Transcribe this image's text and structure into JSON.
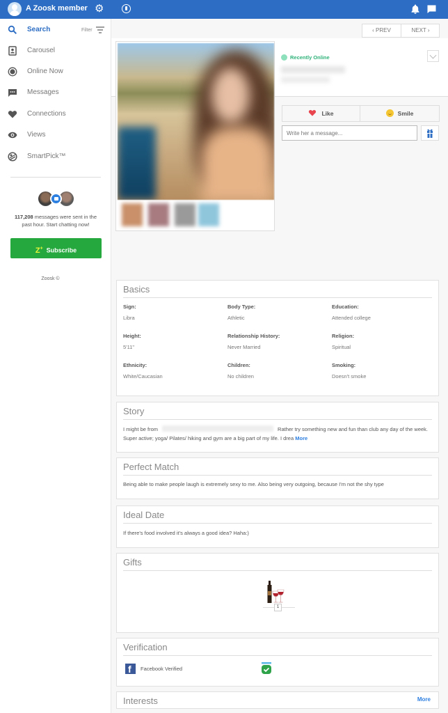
{
  "topbar": {
    "member_name": "A Zoosk member",
    "icons": [
      "avatar",
      "gear-icon",
      "coin-icon",
      "bell-icon",
      "chat-icon"
    ],
    "brand_color": "#2d6ec4"
  },
  "sidebar": {
    "filter_label": "Filter",
    "items": [
      {
        "label": "Search",
        "icon": "search-icon",
        "active": true
      },
      {
        "label": "Carousel",
        "icon": "carousel-icon"
      },
      {
        "label": "Online Now",
        "icon": "online-now-icon"
      },
      {
        "label": "Messages",
        "icon": "messages-icon"
      },
      {
        "label": "Connections",
        "icon": "heart-icon"
      },
      {
        "label": "Views",
        "icon": "eye-icon"
      },
      {
        "label": "SmartPick™",
        "icon": "smartpick-icon"
      }
    ],
    "promo": {
      "count": "117,208",
      "text": " messages were sent in the past hour. Start chatting now!"
    },
    "subscribe": {
      "label": "Subscribe",
      "logo": "Z",
      "color": "#25a83d"
    },
    "copyright": "Zoosk ©"
  },
  "pager": {
    "prev": "‹ PREV",
    "next": "NEXT ›"
  },
  "profile": {
    "status": "Recently Online",
    "status_color": "#2fb27a",
    "like_label": "Like",
    "smile_label": "Smile",
    "message_placeholder": "Write her a message..."
  },
  "basics": {
    "title": "Basics",
    "fields": [
      {
        "label": "Sign:",
        "value": "Libra"
      },
      {
        "label": "Body Type:",
        "value": "Athletic"
      },
      {
        "label": "Education:",
        "value": "Attended college"
      },
      {
        "label": "Height:",
        "value": "5'11\""
      },
      {
        "label": "Relationship History:",
        "value": "Never Married"
      },
      {
        "label": "Religion:",
        "value": "Spiritual"
      },
      {
        "label": "Ethnicity:",
        "value": "White/Caucasian"
      },
      {
        "label": "Children:",
        "value": "No children"
      },
      {
        "label": "Smoking:",
        "value": "Doesn't smoke"
      }
    ]
  },
  "story": {
    "title": "Story",
    "text_start": "I might be from",
    "text_rest": "Rather try something new and fun than club any day of the week. Super active; yoga/ Pilates/ hiking and gym are a big part of my life. I drea",
    "more": "More"
  },
  "perfect_match": {
    "title": "Perfect Match",
    "text": "Being able to make people laugh is extremely sexy to me. Also being very outgoing, because I'm not the shy type"
  },
  "ideal_date": {
    "title": "Ideal Date",
    "text": "If there's food involved it's always a good idea? Haha:)"
  },
  "gifts": {
    "title": "Gifts",
    "items": [
      {
        "name": "wine-gift",
        "count": "1"
      }
    ]
  },
  "verification": {
    "title": "Verification",
    "facebook_label": "Facebook Verified"
  },
  "interests": {
    "title": "Interests",
    "more": "More"
  }
}
